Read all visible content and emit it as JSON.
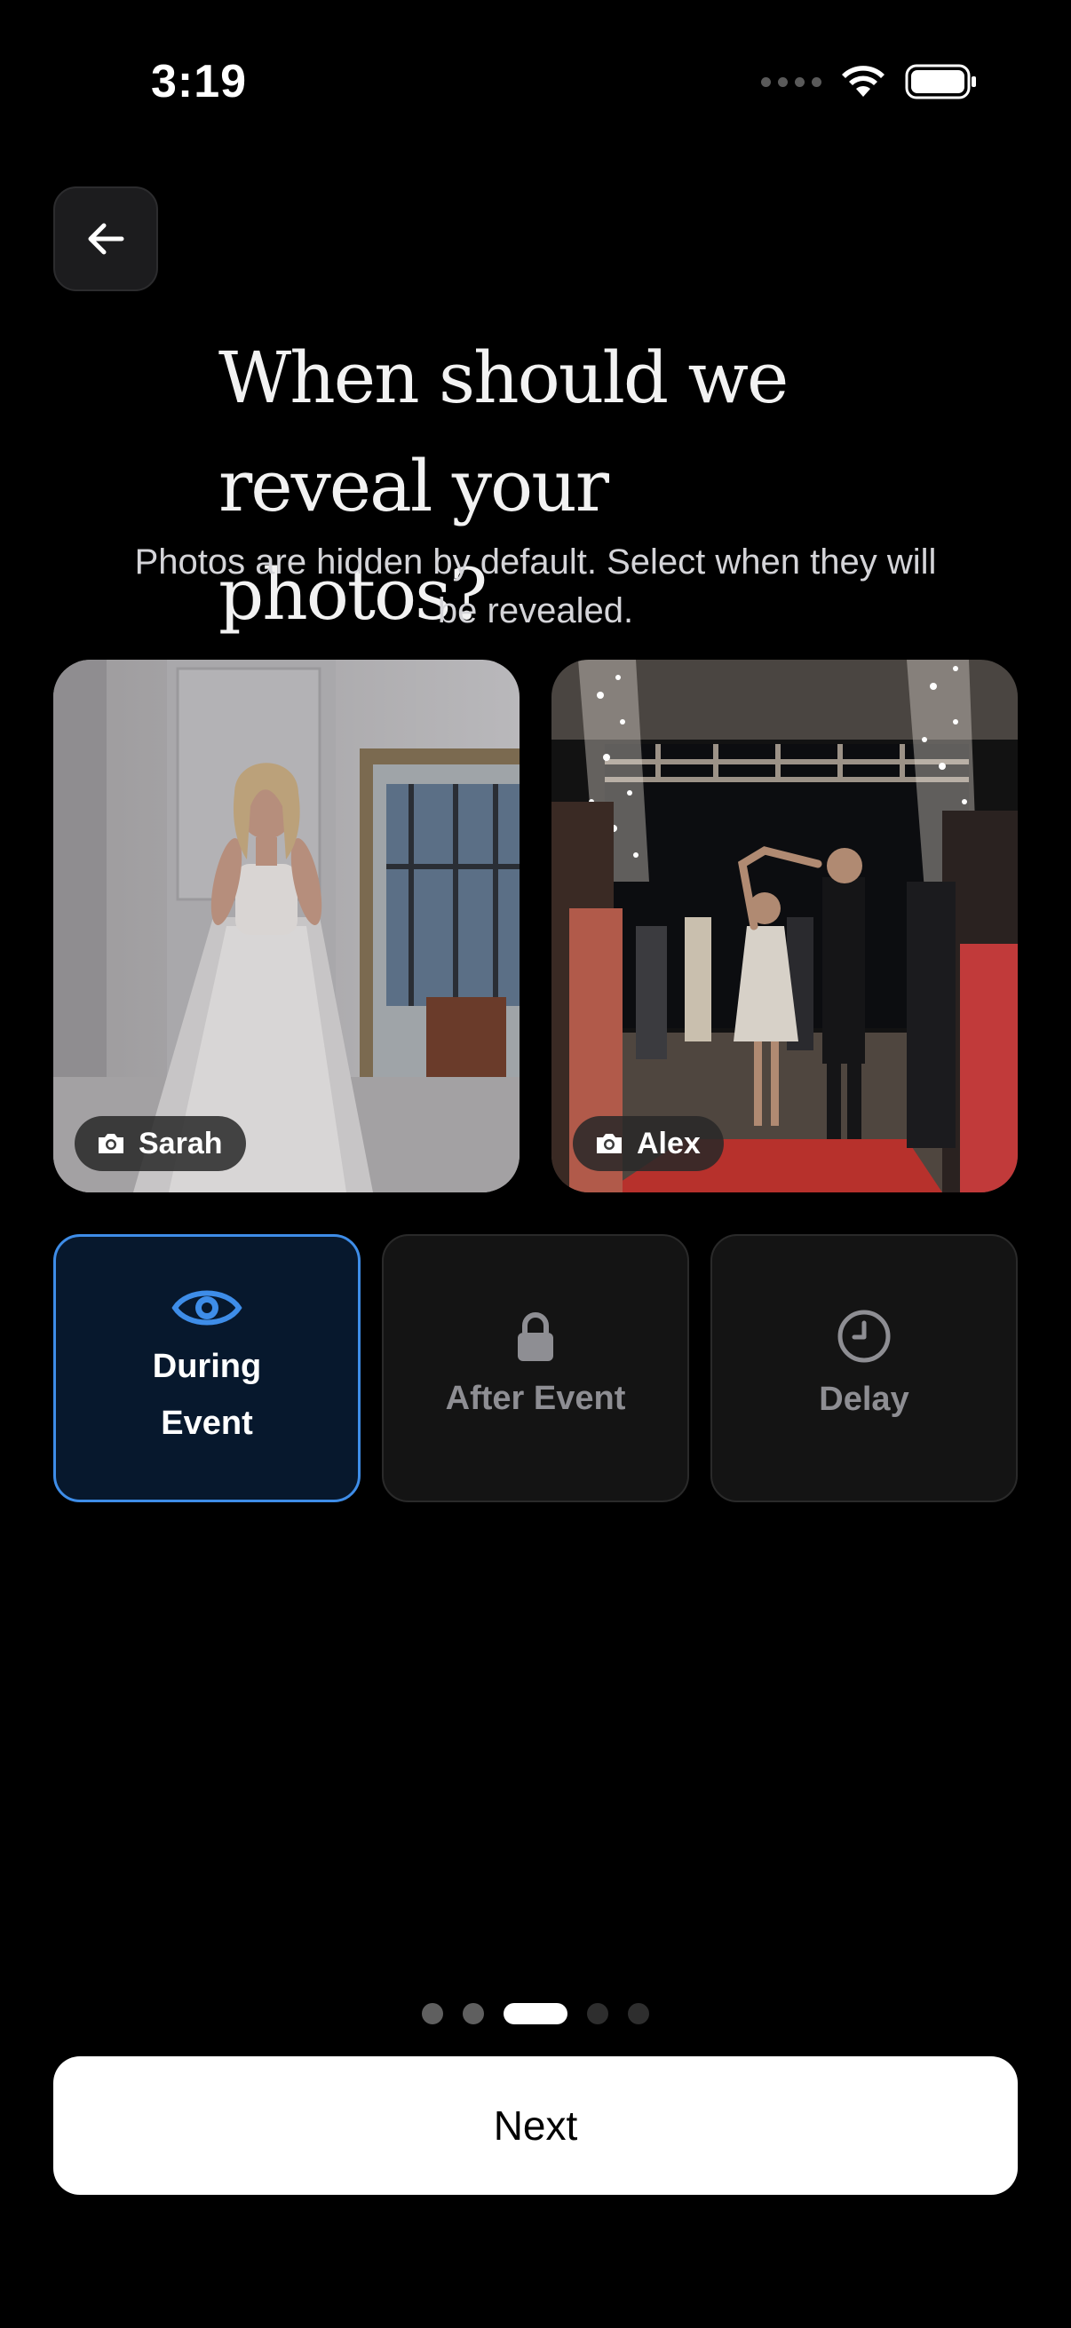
{
  "status_bar": {
    "time": "3:19"
  },
  "header": {
    "back_icon": "arrow-left-icon",
    "title": "When should we reveal your photos?",
    "subtitle": "Photos are hidden by default. Select when they will be revealed."
  },
  "photos": [
    {
      "name": "Sarah",
      "icon": "camera-icon"
    },
    {
      "name": "Alex",
      "icon": "camera-icon"
    }
  ],
  "options": [
    {
      "label": "During Event",
      "icon": "eye-icon",
      "selected": true
    },
    {
      "label": "After Event",
      "icon": "lock-icon",
      "selected": false
    },
    {
      "label": "Delay",
      "icon": "clock-icon",
      "selected": false
    }
  ],
  "pager": {
    "total": 5,
    "current": 3
  },
  "footer": {
    "next_label": "Next"
  },
  "colors": {
    "accent": "#3e8de8",
    "background": "#000000",
    "card": "#141414"
  }
}
